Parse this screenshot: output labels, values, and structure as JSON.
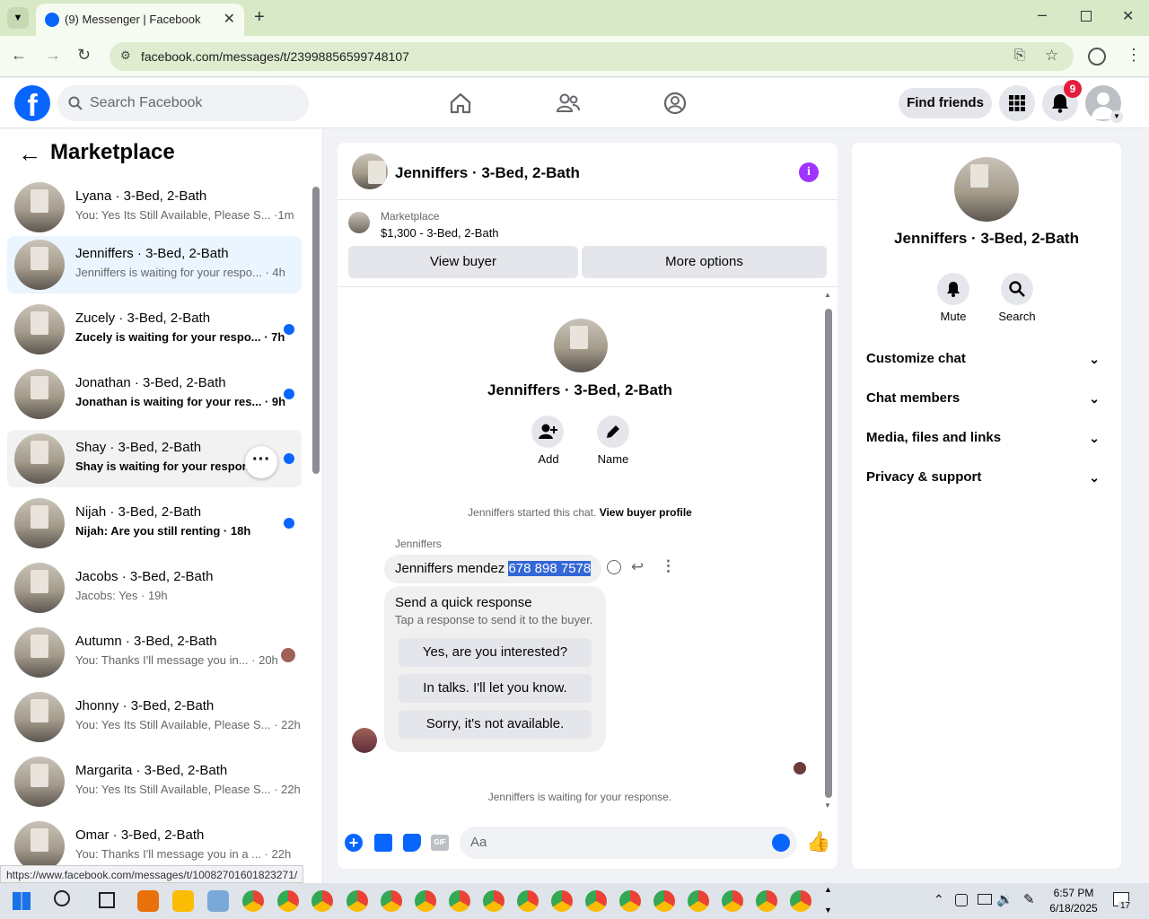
{
  "browser": {
    "tab_title": "(9) Messenger | Facebook",
    "url": "facebook.com/messages/t/23998856599748107",
    "status_url": "https://www.facebook.com/messages/t/10082701601823271/"
  },
  "header": {
    "search_placeholder": "Search Facebook",
    "find_friends": "Find friends",
    "notification_count": "9"
  },
  "sidebar": {
    "title": "Marketplace",
    "conversations": [
      {
        "name": "Lyana · 3-Bed, 2-Bath",
        "preview": "You: Yes Its Still Available, Please S... ·1m",
        "unread": false
      },
      {
        "name": "Jenniffers · 3-Bed, 2-Bath",
        "preview": "Jenniffers is waiting for your respo... · 4h",
        "unread": false
      },
      {
        "name": "Zucely · 3-Bed, 2-Bath",
        "preview": "Zucely is waiting for your respo... · 7h",
        "unread": true
      },
      {
        "name": "Jonathan · 3-Bed, 2-Bath",
        "preview": "Jonathan is waiting for your res... · 9h",
        "unread": true
      },
      {
        "name": "Shay · 3-Bed, 2-Bath",
        "preview": "Shay is waiting for your response",
        "unread": true
      },
      {
        "name": "Nijah · 3-Bed, 2-Bath",
        "preview": "Nijah: Are you still renting · 18h",
        "unread": true
      },
      {
        "name": "Jacobs · 3-Bed, 2-Bath",
        "preview": "Jacobs: Yes · 19h",
        "unread": false
      },
      {
        "name": "Autumn · 3-Bed, 2-Bath",
        "preview": "You: Thanks I'll message you in... · 20h",
        "unread": false
      },
      {
        "name": "Jhonny · 3-Bed, 2-Bath",
        "preview": "You: Yes Its Still Available, Please S... · 22h",
        "unread": false
      },
      {
        "name": "Margarita · 3-Bed, 2-Bath",
        "preview": "You: Yes Its Still Available, Please S... · 22h",
        "unread": false
      },
      {
        "name": "Omar · 3-Bed, 2-Bath",
        "preview": "You: Thanks I'll message you in a ... · 22h",
        "unread": false
      }
    ]
  },
  "chat": {
    "title": "Jenniffers · 3-Bed, 2-Bath",
    "listing_source": "Marketplace",
    "listing_title": "$1,300 - 3-Bed, 2-Bath",
    "view_buyer": "View buyer",
    "more_options": "More options",
    "profile_name": "Jenniffers · 3-Bed, 2-Bath",
    "add_label": "Add",
    "name_label": "Name",
    "started_text": "Jenniffers started this chat.",
    "view_profile": "View buyer profile",
    "sender": "Jenniffers",
    "message_prefix": "Jenniffers mendez ",
    "message_selected": "678 898 7578",
    "quick_title": "Send a quick response",
    "quick_sub": "Tap a response to send it to the buyer.",
    "quick_replies": [
      "Yes, are you interested?",
      "In talks. I'll let you know.",
      "Sorry, it's not available."
    ],
    "waiting": "Jenniffers is waiting for your response.",
    "composer_placeholder": "Aa"
  },
  "details": {
    "name": "Jenniffers · 3-Bed, 2-Bath",
    "mute": "Mute",
    "search": "Search",
    "sections": [
      "Customize chat",
      "Chat members",
      "Media, files and links",
      "Privacy & support"
    ]
  },
  "taskbar": {
    "time": "6:57 PM",
    "date": "6/18/2025",
    "notif": "17"
  },
  "colors": {
    "fb_blue": "#0866ff",
    "messenger_purple": "#a033ff",
    "selection": "#ebf5ff"
  }
}
